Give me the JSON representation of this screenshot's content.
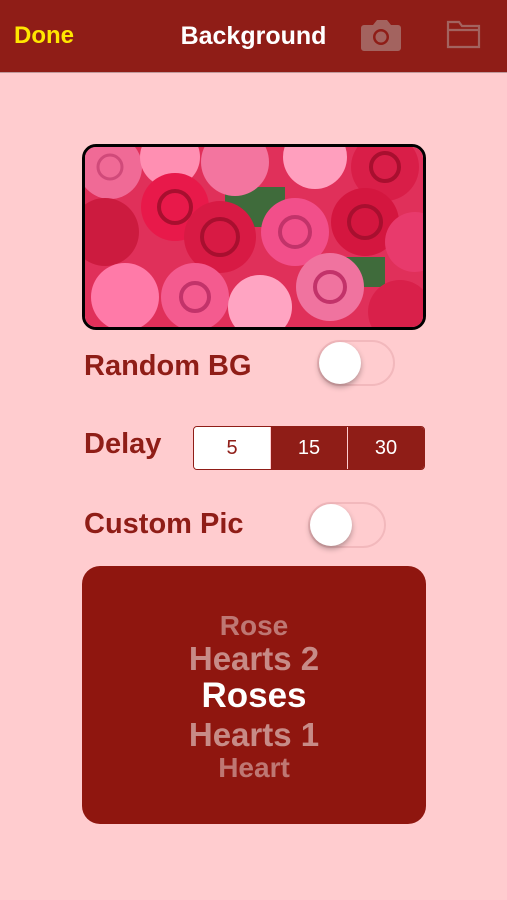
{
  "navbar": {
    "done_label": "Done",
    "title": "Background",
    "camera_icon": "camera-icon",
    "folder_icon": "folder-icon",
    "bg_color": "#8f1d17",
    "done_color": "#ffe600"
  },
  "preview": {
    "image": "roses-background-image"
  },
  "random_bg": {
    "label": "Random BG",
    "on": false
  },
  "delay": {
    "label": "Delay",
    "options": [
      "5",
      "15",
      "30"
    ],
    "selected": "5"
  },
  "custom_pic": {
    "label": "Custom Pic",
    "on": false
  },
  "picker": {
    "items": [
      "Rose",
      "Hearts 2",
      "Roses",
      "Hearts 1",
      "Heart"
    ],
    "selected": "Roses"
  },
  "colors": {
    "page_bg": "#ffcccf",
    "accent": "#8f1d17"
  }
}
